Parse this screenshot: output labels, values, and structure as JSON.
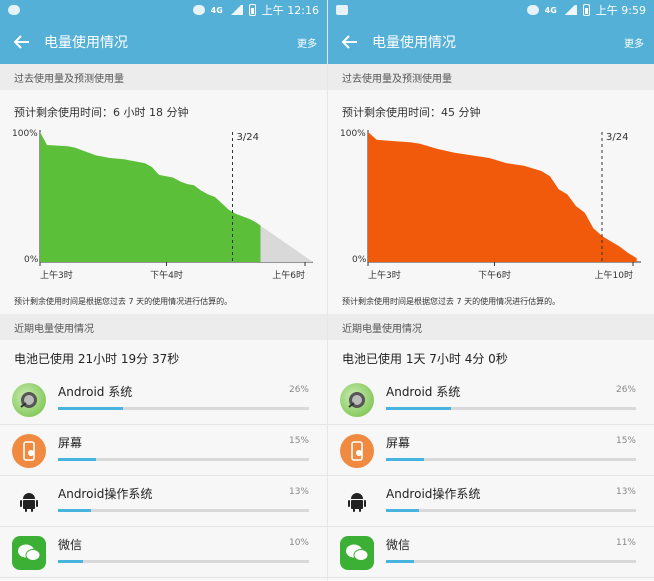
{
  "phones": [
    {
      "status": {
        "time": "上午 12:16",
        "network": "4G"
      },
      "header": {
        "title": "电量使用情况",
        "more_label": "更多"
      },
      "section1": "过去使用量及预测使用量",
      "remaining_text": "预计剩余使用时间：6 小时 18 分钟",
      "chart_data": {
        "type": "area",
        "ylim": [
          0,
          100
        ],
        "y_tick_labels": [
          "100%",
          "0%"
        ],
        "x_tick_labels": [
          "上午3时",
          "下午4时",
          "上午6时"
        ],
        "marker_label": "3/24",
        "x_hours": [
          0,
          1,
          4,
          5,
          6,
          8,
          10,
          12,
          13,
          14,
          15,
          16,
          16.5,
          17,
          18,
          19,
          20,
          21,
          22,
          23,
          24,
          25,
          26,
          27,
          28,
          29,
          30,
          31,
          31.5
        ],
        "y_values": [
          100,
          90,
          89,
          88,
          86,
          82,
          80,
          79,
          78,
          77,
          76,
          73,
          70,
          67,
          66,
          65,
          62,
          60,
          59,
          55,
          52,
          50,
          45,
          40,
          37,
          35,
          33,
          30,
          28
        ],
        "series": [
          {
            "name": "",
            "color": "#5bbf3a",
            "role": "past"
          },
          {
            "name": "",
            "color": "#d9d9d9",
            "role": "predicted"
          }
        ],
        "predicted": {
          "x_hours": [
            31.5,
            39
          ],
          "y_values": [
            28,
            0
          ]
        }
      },
      "note": "预计剩余使用时间是根据您过去 7 天的使用情况进行估算的。",
      "section2": "近期电量使用情况",
      "battery_used": "电池已使用 21小时 19分 37秒",
      "apps": [
        {
          "name": "Android 系统",
          "percent": "26%",
          "value": 26,
          "icon": "android-system-icon"
        },
        {
          "name": "屏幕",
          "percent": "15%",
          "value": 15,
          "icon": "screen-icon"
        },
        {
          "name": "Android操作系统",
          "percent": "13%",
          "value": 13,
          "icon": "android-robot-icon"
        },
        {
          "name": "微信",
          "percent": "10%",
          "value": 10,
          "icon": "wechat-icon"
        }
      ]
    },
    {
      "status": {
        "time": "上午 9:59",
        "network": "4G"
      },
      "header": {
        "title": "电量使用情况",
        "more_label": "更多"
      },
      "section1": "过去使用量及预测使用量",
      "remaining_text": "预计剩余使用时间：45 分钟",
      "chart_data": {
        "type": "area",
        "ylim": [
          0,
          100
        ],
        "y_tick_labels": [
          "100%",
          "0%"
        ],
        "x_tick_labels": [
          "上午3时",
          "下午6时",
          "上午10时"
        ],
        "marker_label": "3/24",
        "x_hours": [
          0,
          1,
          3,
          5,
          6,
          8,
          10,
          12,
          14,
          15,
          16,
          17,
          18,
          19,
          20,
          21,
          22,
          23,
          24,
          25,
          26,
          27,
          28,
          29,
          30,
          31
        ],
        "y_values": [
          100,
          94,
          93,
          92,
          91,
          87,
          84,
          82,
          80,
          78,
          76,
          75,
          74,
          72,
          70,
          66,
          56,
          52,
          43,
          38,
          26,
          20,
          16,
          12,
          7,
          3
        ],
        "series": [
          {
            "name": "",
            "color": "#f05a0a",
            "role": "past"
          }
        ],
        "predicted": null
      },
      "note": "预计剩余使用时间是根据您过去 7 天的使用情况进行估算的。",
      "section2": "近期电量使用情况",
      "battery_used": "电池已使用 1天 7小时 4分 0秒",
      "apps": [
        {
          "name": "Android 系统",
          "percent": "26%",
          "value": 26,
          "icon": "android-system-icon"
        },
        {
          "name": "屏幕",
          "percent": "15%",
          "value": 15,
          "icon": "screen-icon"
        },
        {
          "name": "Android操作系统",
          "percent": "13%",
          "value": 13,
          "icon": "android-robot-icon"
        },
        {
          "name": "微信",
          "percent": "11%",
          "value": 11,
          "icon": "wechat-icon"
        }
      ]
    }
  ]
}
